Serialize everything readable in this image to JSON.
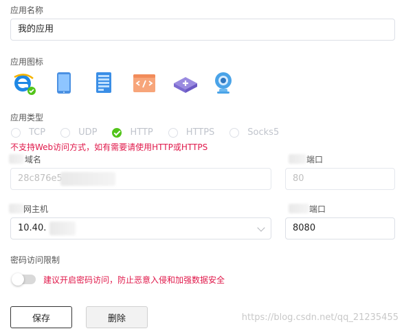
{
  "app_name": {
    "label": "应用名称",
    "value": "我的应用"
  },
  "app_icon": {
    "label": "应用图标",
    "icons": [
      "ie-browser-icon",
      "tablet-icon",
      "server-rack-icon",
      "code-window-icon",
      "network-box-icon",
      "webcam-icon"
    ]
  },
  "app_type": {
    "label": "应用类型",
    "options": [
      "TCP",
      "UDP",
      "HTTP",
      "HTTPS",
      "Socks5"
    ],
    "selected": "HTTP"
  },
  "warning": "不支持Web访问方式，如有需要请使用HTTP或HTTPS",
  "domain": {
    "label": "域名",
    "value": "28c876e5"
  },
  "domain_port": {
    "label": "端口",
    "value": "80"
  },
  "lan_host": {
    "label": "网主机",
    "value": "10.40."
  },
  "lan_port": {
    "label": "端口",
    "value": "8080"
  },
  "password": {
    "label": "密码访问限制",
    "hint": "建议开启密码访问，防止恶意入侵和加强数据安全",
    "enabled": false
  },
  "buttons": {
    "save": "保存",
    "delete": "删除"
  },
  "watermark": "https://blog.csdn.net/qq_21235455",
  "colors": {
    "accent_green": "#52c41a",
    "warning_red": "#e0184a"
  }
}
